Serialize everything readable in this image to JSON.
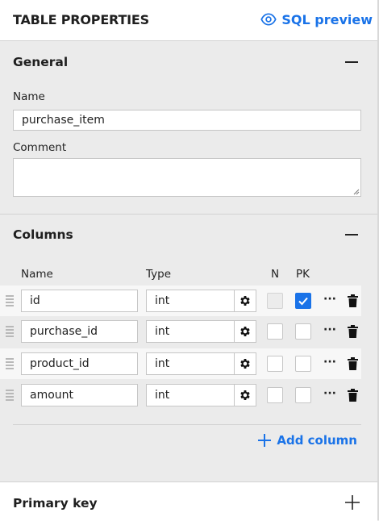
{
  "header": {
    "title": "TABLE PROPERTIES",
    "sql_preview_label": "SQL preview"
  },
  "general": {
    "heading": "General",
    "name_label": "Name",
    "name_value": "purchase_item",
    "comment_label": "Comment",
    "comment_value": ""
  },
  "columns": {
    "heading": "Columns",
    "headers": {
      "name": "Name",
      "type": "Type",
      "nullable": "N",
      "pk": "PK"
    },
    "rows": [
      {
        "name": "id",
        "type": "int",
        "nullable": false,
        "nullable_disabled": true,
        "pk": true
      },
      {
        "name": "purchase_id",
        "type": "int",
        "nullable": false,
        "nullable_disabled": false,
        "pk": false
      },
      {
        "name": "product_id",
        "type": "int",
        "nullable": false,
        "nullable_disabled": false,
        "pk": false
      },
      {
        "name": "amount",
        "type": "int",
        "nullable": false,
        "nullable_disabled": false,
        "pk": false
      }
    ],
    "add_column_label": "Add column"
  },
  "primary_key": {
    "heading": "Primary key"
  },
  "colors": {
    "accent": "#1a73e8",
    "panel_bg": "#ebebeb"
  }
}
